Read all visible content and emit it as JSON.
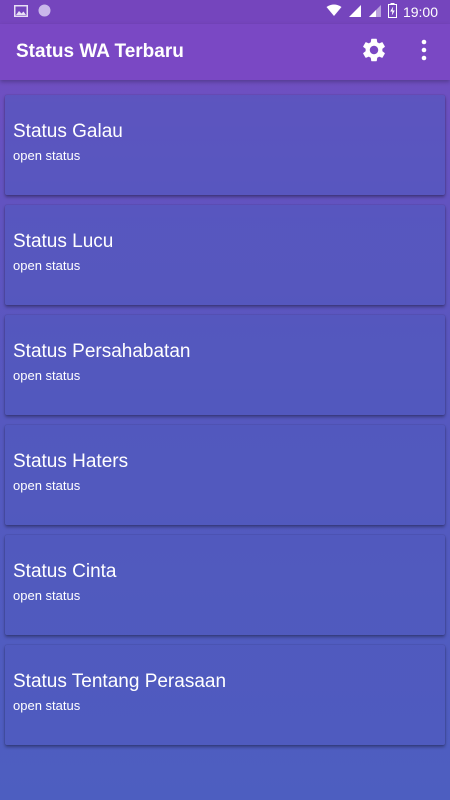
{
  "status_bar": {
    "time": "19:00",
    "icons": [
      "image-icon",
      "circle-notification-icon",
      "wifi-icon",
      "signal-icon",
      "signal-icon",
      "battery-charging-icon"
    ]
  },
  "app_bar": {
    "title": "Status WA Terbaru",
    "actions": [
      "gear-icon",
      "more-vert-icon"
    ],
    "color": "#7a48c4"
  },
  "cards": [
    {
      "title": "Status Galau",
      "subtitle": "open status"
    },
    {
      "title": "Status Lucu",
      "subtitle": "open status"
    },
    {
      "title": "Status Persahabatan",
      "subtitle": "open status"
    },
    {
      "title": "Status Haters",
      "subtitle": "open status"
    },
    {
      "title": "Status Cinta",
      "subtitle": "open status"
    },
    {
      "title": "Status Tentang Perasaan",
      "subtitle": "open status"
    }
  ]
}
